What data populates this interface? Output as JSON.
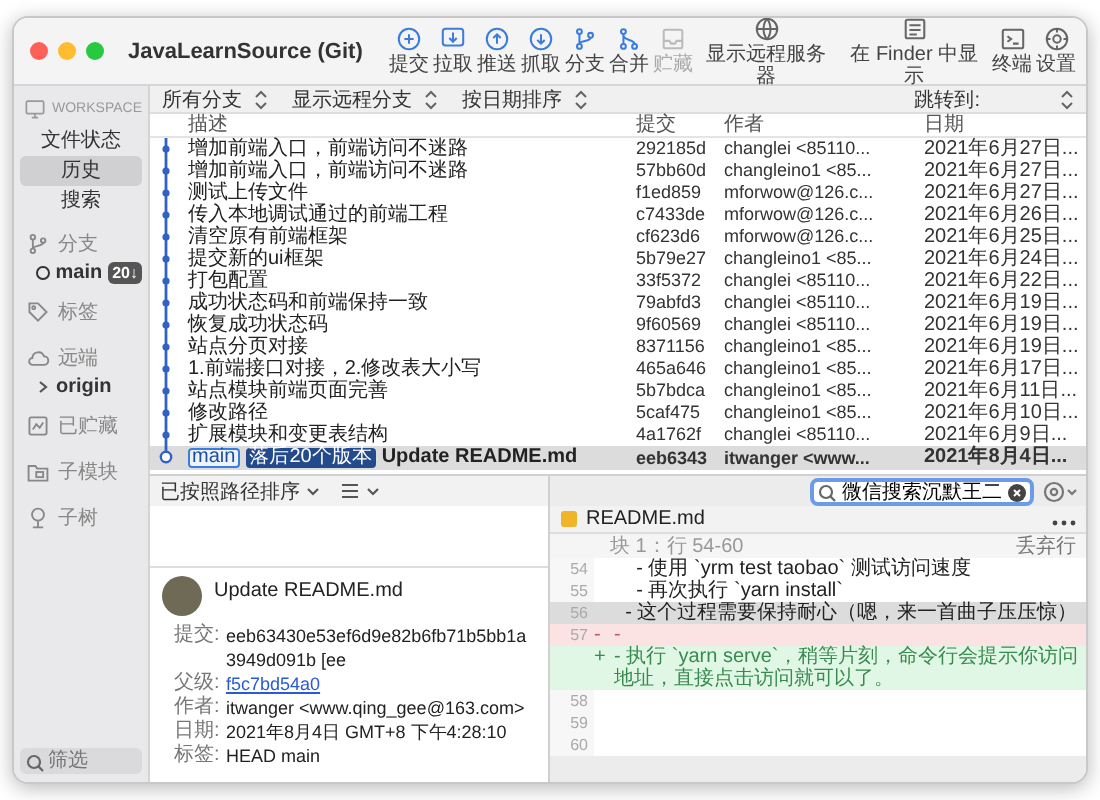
{
  "window": {
    "title": "JavaLearnSource (Git)"
  },
  "toolbar": {
    "items": [
      {
        "kind": "commit",
        "label": "提交",
        "disabled": false
      },
      {
        "kind": "pull",
        "label": "拉取",
        "disabled": false
      },
      {
        "kind": "push",
        "label": "推送",
        "disabled": false
      },
      {
        "kind": "fetch",
        "label": "抓取",
        "disabled": false
      },
      {
        "kind": "branch",
        "label": "分支",
        "disabled": false
      },
      {
        "kind": "merge",
        "label": "合并",
        "disabled": false
      },
      {
        "kind": "stash",
        "label": "贮藏",
        "disabled": true
      },
      {
        "kind": "remote",
        "label": "显示远程服务器",
        "disabled": false
      },
      {
        "kind": "finder",
        "label": "在 Finder 中显示",
        "disabled": false
      },
      {
        "kind": "terminal",
        "label": "终端",
        "disabled": false
      },
      {
        "kind": "settings",
        "label": "设置",
        "disabled": false
      }
    ]
  },
  "sidebar": {
    "workspace": {
      "label": "WORKSPACE",
      "items": [
        {
          "label": "文件状态",
          "selected": false
        },
        {
          "label": "历史",
          "selected": true
        },
        {
          "label": "搜索",
          "selected": false
        }
      ]
    },
    "sections": [
      {
        "kind": "branches",
        "label": "分支",
        "branches": [
          {
            "label": "main",
            "badge": "20↓",
            "current": true
          }
        ]
      },
      {
        "kind": "tags",
        "label": "标签"
      },
      {
        "kind": "remotes",
        "label": "远端",
        "remotes": [
          {
            "label": "origin",
            "expanded": false
          }
        ]
      },
      {
        "kind": "stashes",
        "label": "已贮藏"
      },
      {
        "kind": "submodules",
        "label": "子模块"
      },
      {
        "kind": "subtrees",
        "label": "子树"
      }
    ],
    "filter": {
      "placeholder": "筛选"
    }
  },
  "history": {
    "filters": [
      {
        "label": "所有分支"
      },
      {
        "label": "显示远程分支"
      },
      {
        "label": "按日期排序"
      }
    ],
    "jump": {
      "label": "跳转到:"
    },
    "columns": [
      "描述",
      "提交",
      "作者",
      "日期"
    ],
    "rows": [
      {
        "description": "增加前端入口，前端访问不迷路",
        "commit": "292185d",
        "author": "changlei <85110...",
        "date": "2021年6月27日...",
        "selected": false
      },
      {
        "description": "增加前端入口，前端访问不迷路",
        "commit": "57bb60d",
        "author": "changleino1 <85...",
        "date": "2021年6月27日...",
        "selected": false
      },
      {
        "description": "测试上传文件",
        "commit": "f1ed859",
        "author": "mforwow@126.c...",
        "date": "2021年6月27日...",
        "selected": false
      },
      {
        "description": "传入本地调试通过的前端工程",
        "commit": "c7433de",
        "author": "mforwow@126.c...",
        "date": "2021年6月26日...",
        "selected": false
      },
      {
        "description": "清空原有前端框架",
        "commit": "cf623d6",
        "author": "mforwow@126.c...",
        "date": "2021年6月25日...",
        "selected": false
      },
      {
        "description": "提交新的ui框架",
        "commit": "5b79e27",
        "author": "changleino1 <85...",
        "date": "2021年6月24日...",
        "selected": false
      },
      {
        "description": "打包配置",
        "commit": "33f5372",
        "author": "changlei <85110...",
        "date": "2021年6月22日...",
        "selected": false
      },
      {
        "description": "成功状态码和前端保持一致",
        "commit": "79abfd3",
        "author": "changlei <85110...",
        "date": "2021年6月19日...",
        "selected": false
      },
      {
        "description": "恢复成功状态码",
        "commit": "9f60569",
        "author": "changlei <85110...",
        "date": "2021年6月19日...",
        "selected": false
      },
      {
        "description": "站点分页对接",
        "commit": "8371156",
        "author": "changleino1 <85...",
        "date": "2021年6月19日...",
        "selected": false
      },
      {
        "description": "1.前端接口对接，2.修改表大小写",
        "commit": "465a646",
        "author": "changleino1 <85...",
        "date": "2021年6月17日...",
        "selected": false
      },
      {
        "description": "站点模块前端页面完善",
        "commit": "5b7bdca",
        "author": "changleino1 <85...",
        "date": "2021年6月11日...",
        "selected": false
      },
      {
        "description": "修改路径",
        "commit": "5caf475",
        "author": "changleino1 <85...",
        "date": "2021年6月10日...",
        "selected": false
      },
      {
        "description": "扩展模块和变更表结构",
        "commit": "4a1762f",
        "author": "changlei <85110...",
        "date": "2021年6月9日...",
        "selected": false
      },
      {
        "description": "Update README.md",
        "commit": "eeb6343",
        "author": "itwanger <www...",
        "date": "2021年8月4日...",
        "selected": true,
        "tags": [
          {
            "kind": "branch",
            "label": "main"
          },
          {
            "kind": "behind",
            "label": "落后20个版本"
          }
        ]
      }
    ]
  },
  "detail": {
    "sort": {
      "label": "已按照路径排序"
    },
    "commit": {
      "title": "Update README.md",
      "fields": [
        {
          "label": "提交:",
          "value": "eeb63430e53ef6d9e82b6fb71b5bb1a3949d091b [ee",
          "kind": "text"
        },
        {
          "label": "父级:",
          "value": "f5c7bd54a0",
          "kind": "link"
        },
        {
          "label": "作者:",
          "value": "itwanger <www.qing_gee@163.com>",
          "kind": "text"
        },
        {
          "label": "日期:",
          "value": "2021年8月4日 GMT+8 下午4:28:10",
          "kind": "text"
        },
        {
          "label": "标签:",
          "value": "HEAD main",
          "kind": "text"
        }
      ]
    }
  },
  "diff": {
    "search": {
      "value": "微信搜索沉默王二"
    },
    "file": {
      "name": "README.md"
    },
    "hunk": {
      "title": "块 1：行 54-60",
      "action": "丢弃行"
    },
    "lines": [
      {
        "kind": "context",
        "number": "54",
        "text": "    - 使用 `yrm test taobao` 测试访问速度",
        "selected": false
      },
      {
        "kind": "context",
        "number": "55",
        "text": "    - 再次执行 `yarn install`",
        "selected": false
      },
      {
        "kind": "context",
        "number": "56",
        "text": "  - 这个过程需要保持耐心（嗯，来一首曲子压压惊）",
        "selected": true
      },
      {
        "kind": "removed",
        "number": "57",
        "sign": "-",
        "text": "-",
        "selected": false
      },
      {
        "kind": "added",
        "sign": "+",
        "text": "- 执行 `yarn serve`，稍等片刻，命令行会提示你访问地址，直接点击访问就可以了。",
        "selected": false
      },
      {
        "kind": "context",
        "number": "58",
        "selected": false
      },
      {
        "kind": "context",
        "number": "59",
        "selected": false
      },
      {
        "kind": "context",
        "number": "60",
        "selected": false
      }
    ]
  }
}
